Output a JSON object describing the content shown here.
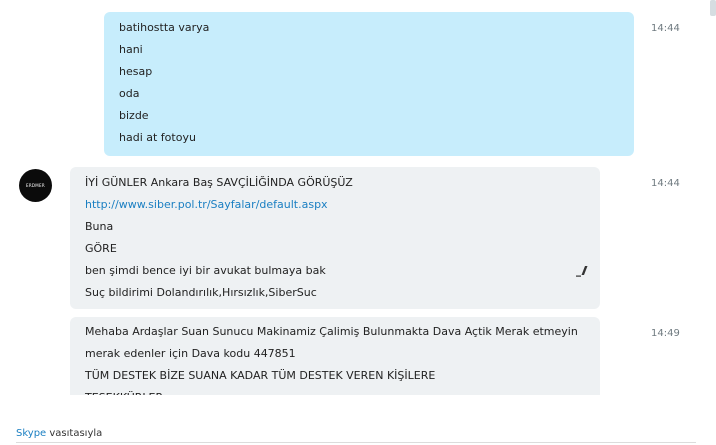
{
  "messages": [
    {
      "direction": "outgoing",
      "time": "14:44",
      "lines": [
        "batihostta varya",
        "hani",
        "hesap",
        "oda",
        "bizde",
        "hadi at fotoyu"
      ]
    },
    {
      "direction": "incoming",
      "time": "14:44",
      "avatar_text": "ERDMER",
      "lines": [
        "İYİ GÜNLER Ankara Baş SAVÇİLİĞİNDA GÖRÜŞÜZ",
        "http://www.siber.pol.tr/Sayfalar/default.aspx",
        "Buna",
        "GÖRE",
        "ben şimdi bence  iyi bir avukat bulmaya bak",
        "Suç bildirimi Dolandırılık,Hırsızlık,SiberSuc"
      ]
    },
    {
      "direction": "incoming",
      "time": "14:49",
      "lines": [
        "Mehaba Ardaşlar Suan Sunucu Makinamiz Çalimiş Bulunmakta Dava Açtik Merak etmeyin",
        "merak edenler için Dava kodu 447851",
        "TÜM DESTEK BİZE SUANA KADAR TÜM DESTEK VEREN KİŞİLERE",
        "TEŞEKKÜRLER"
      ]
    }
  ],
  "footer": {
    "brand": "Skype",
    "suffix": " vasıtasıyla"
  },
  "icons": {
    "edit": "pencil-edit-icon"
  },
  "colors": {
    "outgoing_bubble": "#c7edfc",
    "incoming_bubble": "#eef1f3",
    "link": "#1a7fc2"
  }
}
